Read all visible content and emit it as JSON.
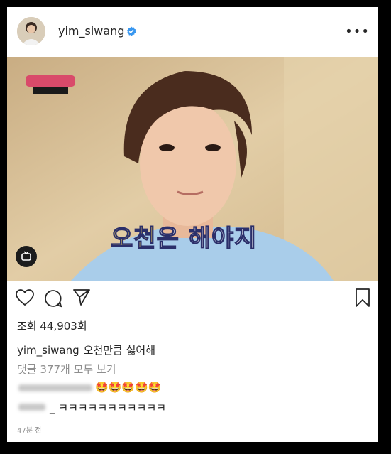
{
  "post": {
    "username": "yim_siwang",
    "more_icon": "ellipsis-icon",
    "subtitle": "오천은 해야지",
    "subtitle_highlight": "오천",
    "subtitle_rest": "은 해야지",
    "views": "조회 44,903회",
    "caption_user": "yim_siwang",
    "caption_text": "오천만큼 싫어해",
    "view_all_comments": "댓글 377개 모두 보기",
    "comments": [
      {
        "text": "🤩🤩🤩🤩🤩"
      },
      {
        "text": "_ ㅋㅋㅋㅋㅋㅋㅋㅋㅋㅋㅋ"
      }
    ],
    "time_ago": "47분 전"
  },
  "colors": {
    "verified_blue": "#3897f0",
    "text": "#262626",
    "muted": "#8e8e8e",
    "subtitle_yellow": "#ffe05a"
  }
}
